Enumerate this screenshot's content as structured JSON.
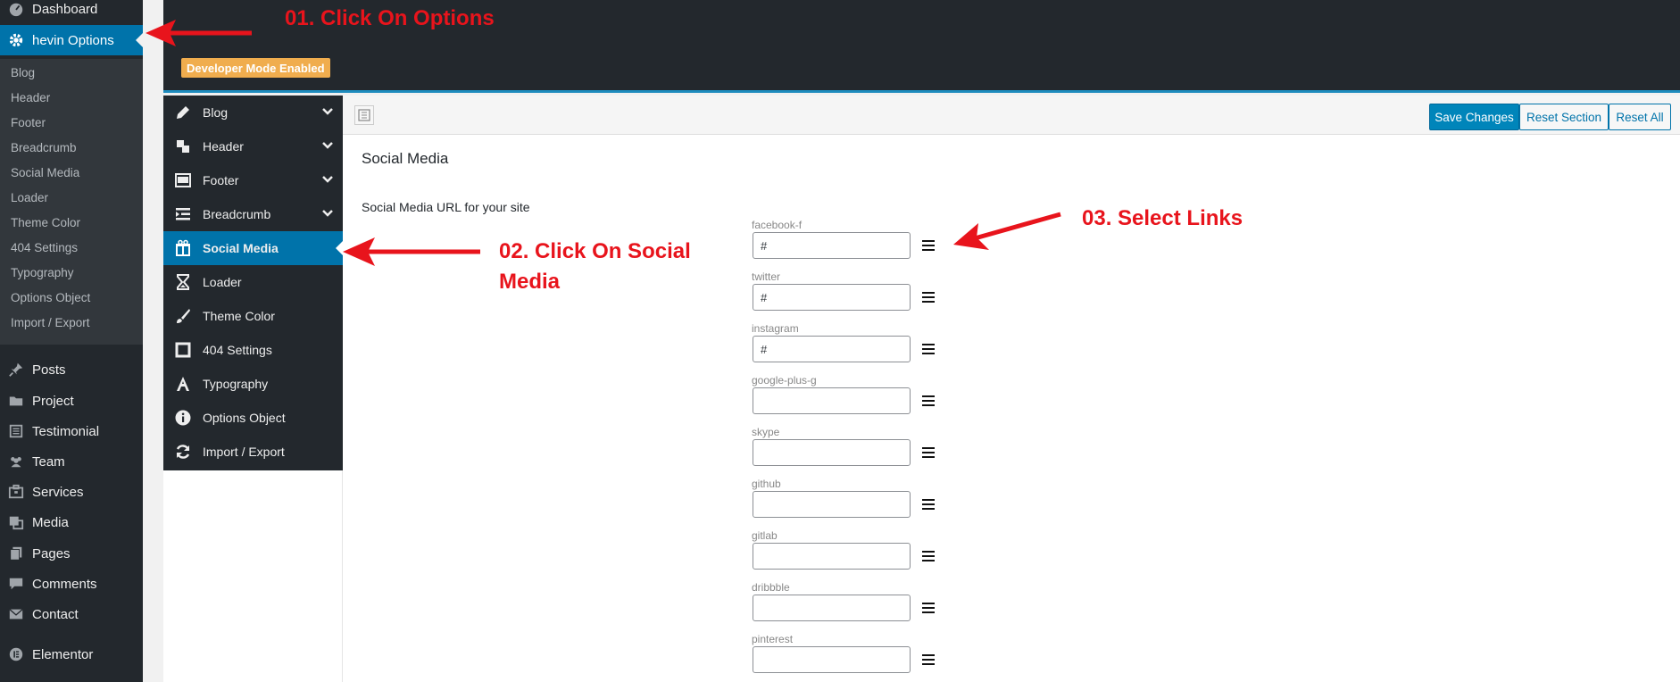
{
  "admin_menu": {
    "dashboard": "Dashboard",
    "options": "hevin Options",
    "submenu": [
      "Blog",
      "Header",
      "Footer",
      "Breadcrumb",
      "Social Media",
      "Loader",
      "Theme Color",
      "404 Settings",
      "Typography",
      "Options Object",
      "Import / Export"
    ],
    "items": [
      {
        "label": "Posts",
        "icon": "pin-icon"
      },
      {
        "label": "Project",
        "icon": "folder-icon"
      },
      {
        "label": "Testimonial",
        "icon": "list-icon"
      },
      {
        "label": "Team",
        "icon": "groups-icon"
      },
      {
        "label": "Services",
        "icon": "services-icon"
      },
      {
        "label": "Media",
        "icon": "media-icon"
      },
      {
        "label": "Pages",
        "icon": "pages-icon"
      },
      {
        "label": "Comments",
        "icon": "comment-icon"
      },
      {
        "label": "Contact",
        "icon": "mail-icon"
      },
      {
        "label": "Elementor",
        "icon": "elementor-icon"
      }
    ]
  },
  "header": {
    "badge": "Developer Mode Enabled"
  },
  "nav": [
    {
      "label": "Blog",
      "icon": "pencil-icon",
      "expandable": true
    },
    {
      "label": "Header",
      "icon": "header-icon",
      "expandable": true
    },
    {
      "label": "Footer",
      "icon": "footer-icon",
      "expandable": true
    },
    {
      "label": "Breadcrumb",
      "icon": "breadcrumb-icon",
      "expandable": true
    },
    {
      "label": "Social Media",
      "icon": "gift-icon",
      "expandable": false,
      "active": true
    },
    {
      "label": "Loader",
      "icon": "hourglass-icon",
      "expandable": false
    },
    {
      "label": "Theme Color",
      "icon": "brush-icon",
      "expandable": false
    },
    {
      "label": "404 Settings",
      "icon": "square-icon",
      "expandable": false
    },
    {
      "label": "Typography",
      "icon": "font-icon",
      "expandable": false
    },
    {
      "label": "Options Object",
      "icon": "info-icon",
      "expandable": false
    },
    {
      "label": "Import / Export",
      "icon": "refresh-icon",
      "expandable": false
    }
  ],
  "toolbar": {
    "save": "Save Changes",
    "reset_section": "Reset Section",
    "reset_all": "Reset All"
  },
  "section": {
    "title": "Social Media",
    "field_title": "Social Media URL for your site"
  },
  "social_fields": [
    {
      "label": "facebook-f",
      "value": "#"
    },
    {
      "label": "twitter",
      "value": "#"
    },
    {
      "label": "instagram",
      "value": "#"
    },
    {
      "label": "google-plus-g",
      "value": ""
    },
    {
      "label": "skype",
      "value": ""
    },
    {
      "label": "github",
      "value": ""
    },
    {
      "label": "gitlab",
      "value": ""
    },
    {
      "label": "dribbble",
      "value": ""
    },
    {
      "label": "pinterest",
      "value": ""
    }
  ],
  "annotations": {
    "step1": "01. Click On Options",
    "step2_line1": "02. Click On Social",
    "step2_line2": "Media",
    "step3": "03. Select Links",
    "color": "#e8141c"
  },
  "colors": {
    "admin_bg": "#23282d",
    "accent": "#0073aa",
    "badge": "#f0ad4e"
  }
}
